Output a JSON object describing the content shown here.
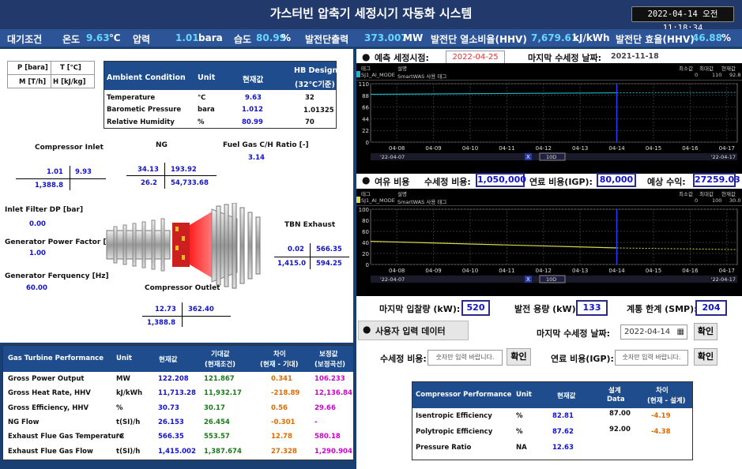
{
  "header": {
    "title": "가스터빈 압축기 세정시기 자동화 시스템",
    "clock": "2022-04-14 오전 11:18:34"
  },
  "conditions": {
    "label": "대기조건",
    "temp_label": "온도",
    "temp": "9.63",
    "temp_unit": "℃",
    "press_label": "압력",
    "press": "1.01",
    "press_unit": "bara",
    "hum_label": "습도",
    "hum": "80.99",
    "hum_unit": "%",
    "out_label": "발전단출력",
    "out": "373.007",
    "out_unit": "MW",
    "hr_label": "발전단 열소비율(HHV)",
    "hr": "7,679.61",
    "hr_unit": "kJ/kWh",
    "eff_label": "발전단 효율(HHV)",
    "eff": "46.88",
    "eff_unit": "%"
  },
  "legend_box": {
    "p": "P [bara]",
    "t": "T [℃]",
    "m": "M [T/h]",
    "h": "H [kJ/kg]"
  },
  "ambient": {
    "h1": "Ambient Condition",
    "h2": "Unit",
    "h3": "현재값",
    "h4": "HB Design",
    "h4b": "(32℃기준)",
    "rows": [
      {
        "name": "Temperature",
        "unit": "℃",
        "cur": "9.63",
        "design": "32"
      },
      {
        "name": "Barometic Pressure",
        "unit": "bara",
        "cur": "1.012",
        "design": "1.01325"
      },
      {
        "name": "Relative Humidity",
        "unit": "%",
        "cur": "80.99",
        "design": "70"
      }
    ]
  },
  "diagram": {
    "ci_title": "Compressor Inlet",
    "ci_p": "1.01",
    "ci_t": "9.93",
    "ci_m": "1,388.8",
    "ng_title": "NG",
    "ng_p": "34.13",
    "ng_t": "193.92",
    "ng_m": "26.2",
    "ng_h": "54,733.68",
    "fg_title": "Fuel Gas C/H Ratio [-]",
    "fg_val": "3.14",
    "ifd_title": "Inlet Filter DP [bar]",
    "ifd_val": "0.00",
    "gpf_title": "Generator Power Factor [-]",
    "gpf_val": "1.00",
    "gf_title": "Generator Ferquency [Hz]",
    "gf_val": "60.00",
    "te_title": "TBN Exhaust",
    "te_p": "0.02",
    "te_t": "566.35",
    "te_m": "1,415.0",
    "te_h": "594.25",
    "co_title": "Compressor Outlet",
    "co_p": "12.73",
    "co_t": "362.40",
    "co_m": "1,388.8"
  },
  "forecast": {
    "title": "예측 세정시점:",
    "date": "2022-04-25",
    "last_label": "마지막 수세정 날짜:",
    "last_date": "2021-11-18"
  },
  "trend1": {
    "col_tag": "태그",
    "col_desc": "설명",
    "col_min": "최소값",
    "col_max": "최대값",
    "col_cur": "현재값",
    "tag": "SJ1_AI_MODE",
    "desc": "SmartWAS 사용 태그",
    "min": "0",
    "max": "110",
    "cur": "92.8",
    "y_ticks": [
      "110",
      "88",
      "66",
      "44",
      "22",
      "0"
    ],
    "x_ticks": [
      "04-08",
      "04-09",
      "04-10",
      "04-11",
      "04-12",
      "04-13",
      "04-14",
      "04-15",
      "04-16",
      "04-17"
    ],
    "start": "'22-04-07",
    "end": "'22-04-17",
    "range": "10D"
  },
  "margin": {
    "title": "여유 비용",
    "wash_label": "수세정 비용:",
    "wash": "1,050,000",
    "fuel_label": "연료 비용(IGP):",
    "fuel": "80,000",
    "profit_label": "예상 수익:",
    "profit": "27259.03"
  },
  "trend2": {
    "col_tag": "태그",
    "col_desc": "설명",
    "col_min": "최소값",
    "col_max": "최대값",
    "col_cur": "현재값",
    "tag": "SJ1_AI_MODE",
    "desc": "SmartWAS 사용 태그",
    "min": "0",
    "max": "100",
    "cur": "30.0",
    "y_ticks": [
      "100",
      "80",
      "60",
      "40",
      "20",
      "0"
    ],
    "x_ticks": [
      "04-08",
      "04-09",
      "04-10",
      "04-11",
      "04-12",
      "04-13",
      "04-14",
      "04-15",
      "04-16",
      "04-17"
    ],
    "start": "'22-04-07",
    "end": "'22-04-17",
    "range": "10D"
  },
  "grid": {
    "last_label": "마지막 입찰량 (kW):",
    "last": "520",
    "cap_label": "발전 용량 (kW):",
    "cap": "133",
    "sys_label": "계통 한계 (SMP):",
    "sys": "204"
  },
  "user": {
    "title": "사용자 입력 데이터",
    "last_label": "마지막 수세정 날짜:",
    "last_date": "2022-04-14",
    "confirm": "확인",
    "wash_label": "수세정 비용:",
    "placeholder": "숫자만 입력 바랍니다.",
    "fuel_label": "연료 비용(IGP):"
  },
  "gtp": {
    "h1": "Gas Turbine Performance",
    "h2": "Unit",
    "h3": "현재값",
    "h4": "기대값",
    "h4b": "(현재조건)",
    "h5": "차이",
    "h5b": "(현재 - 기대)",
    "h6": "보정값",
    "h6b": "(보정곡선)",
    "rows": [
      {
        "name": "Gross Power Output",
        "unit": "MW",
        "cur": "122.208",
        "exp": "121.867",
        "diff": "0.341",
        "corr": "106.233"
      },
      {
        "name": "Gross Heat Rate, HHV",
        "unit": "kJ/kWh",
        "cur": "11,713.28",
        "exp": "11,932.17",
        "diff": "-218.89",
        "corr": "12,136.84"
      },
      {
        "name": "Gross Efficiency, HHV",
        "unit": "%",
        "cur": "30.73",
        "exp": "30.17",
        "diff": "0.56",
        "corr": "29.66"
      },
      {
        "name": "NG Flow",
        "unit": "t(SI)/h",
        "cur": "26.153",
        "exp": "26.454",
        "diff": "-0.301",
        "corr": "-"
      },
      {
        "name": "Exhaust Flue Gas Temperature",
        "unit": "℃",
        "cur": "566.35",
        "exp": "553.57",
        "diff": "12.78",
        "corr": "580.18"
      },
      {
        "name": "Exhaust Flue Gas Flow",
        "unit": "t(SI)/h",
        "cur": "1,415.002",
        "exp": "1,387.674",
        "diff": "27.328",
        "corr": "1,290.904"
      }
    ]
  },
  "cp": {
    "h1": "Compressor Performance",
    "h2": "Unit",
    "h3": "현재값",
    "h4": "설계",
    "h4b": "Data",
    "h5": "차이",
    "h5b": "(현재 - 설계)",
    "rows": [
      {
        "name": "Isentropic Efficiency",
        "unit": "%",
        "cur": "82.81",
        "design": "87.00",
        "diff": "-4.19"
      },
      {
        "name": "Polytropic Efficiency",
        "unit": "%",
        "cur": "87.62",
        "design": "92.00",
        "diff": "-4.38"
      },
      {
        "name": "Pressure Ratio",
        "unit": "NA",
        "cur": "12.63",
        "design": "",
        "diff": ""
      }
    ]
  },
  "colors": {
    "header_bg": "#1e4c8c",
    "trend1_line": "#17b8c8",
    "trend2_line": "#d8d84a",
    "marker": "#2f3cff"
  }
}
